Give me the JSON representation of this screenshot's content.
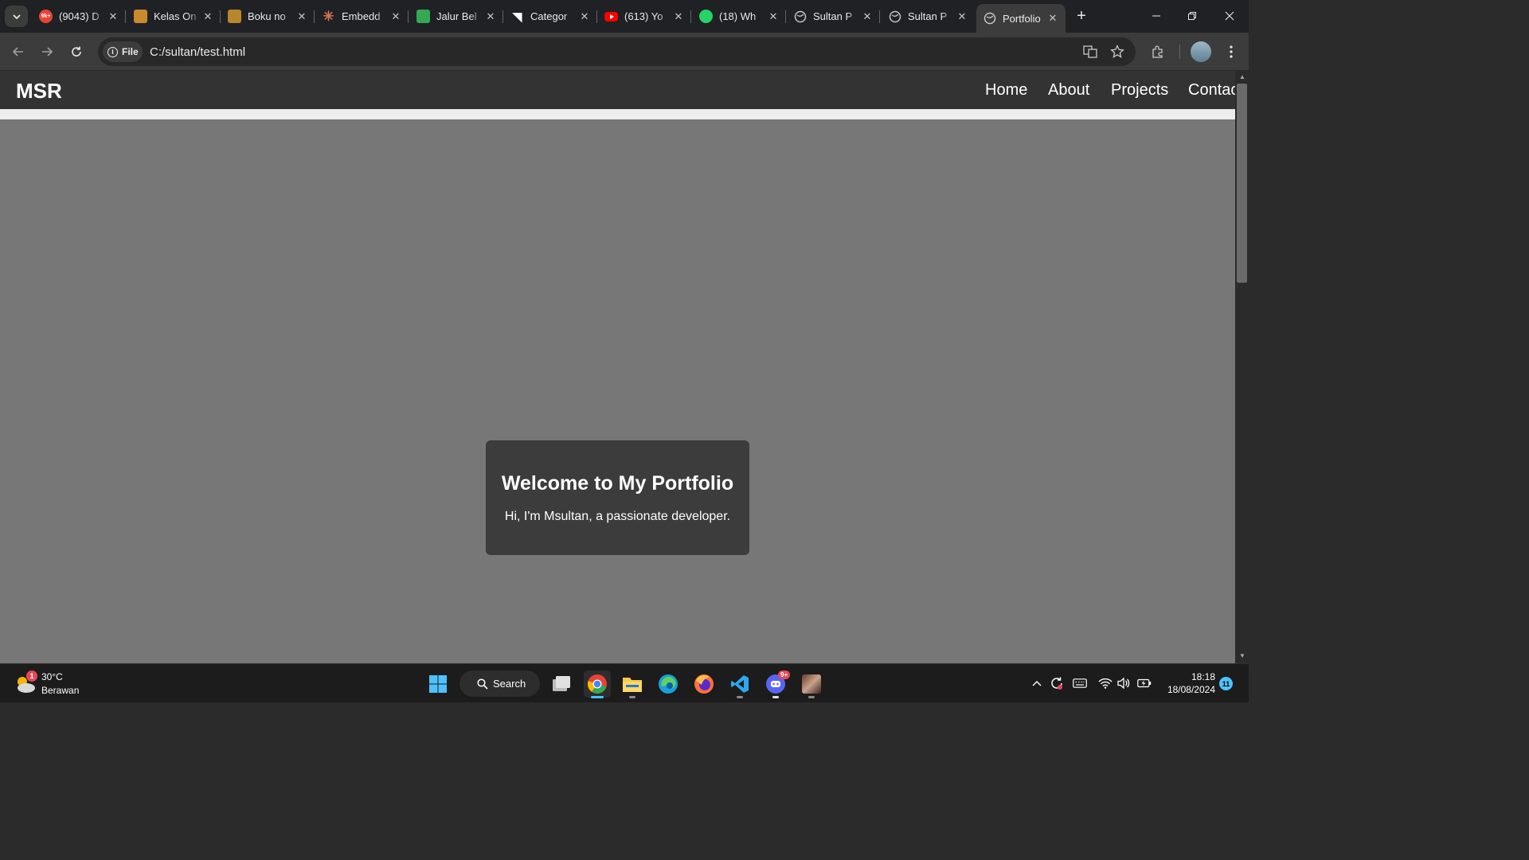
{
  "browser": {
    "tabs": [
      {
        "title": "(9043) D",
        "favicon": "gmail-icon",
        "badge": "9k+"
      },
      {
        "title": "Kelas On",
        "favicon": "stack-icon"
      },
      {
        "title": "Boku no",
        "favicon": "manga-icon"
      },
      {
        "title": "Embedd",
        "favicon": "claude-icon"
      },
      {
        "title": "Jalur Bel",
        "favicon": "sheets-icon"
      },
      {
        "title": "Categor",
        "favicon": "bookmark-icon"
      },
      {
        "title": "(613) Yo",
        "favicon": "youtube-icon"
      },
      {
        "title": "(18) Wh",
        "favicon": "whatsapp-icon"
      },
      {
        "title": "Sultan P",
        "favicon": "globe-icon"
      },
      {
        "title": "Sultan P",
        "favicon": "globe-icon"
      },
      {
        "title": "Portfolio",
        "favicon": "globe-icon",
        "active": true
      }
    ],
    "address": {
      "chip_label": "File",
      "url": "C:/sultan/test.html"
    }
  },
  "site": {
    "logo": "MSR",
    "nav": [
      "Home",
      "About",
      "Projects",
      "Contac"
    ],
    "welcome": {
      "heading": "Welcome to My Portfolio",
      "text": "Hi, I'm Msultan, a passionate developer."
    }
  },
  "taskbar": {
    "weather": {
      "temp": "30°C",
      "desc": "Berawan",
      "badge": "1"
    },
    "search_label": "Search",
    "discord_badge": "9+",
    "time": "18:18",
    "date": "18/08/2024",
    "notification_count": "11"
  },
  "colors": {
    "page_bg": "#777777",
    "site_nav_bg": "#333333",
    "card_bg": "#3c3c3c",
    "accent": "#4cc2ff"
  }
}
